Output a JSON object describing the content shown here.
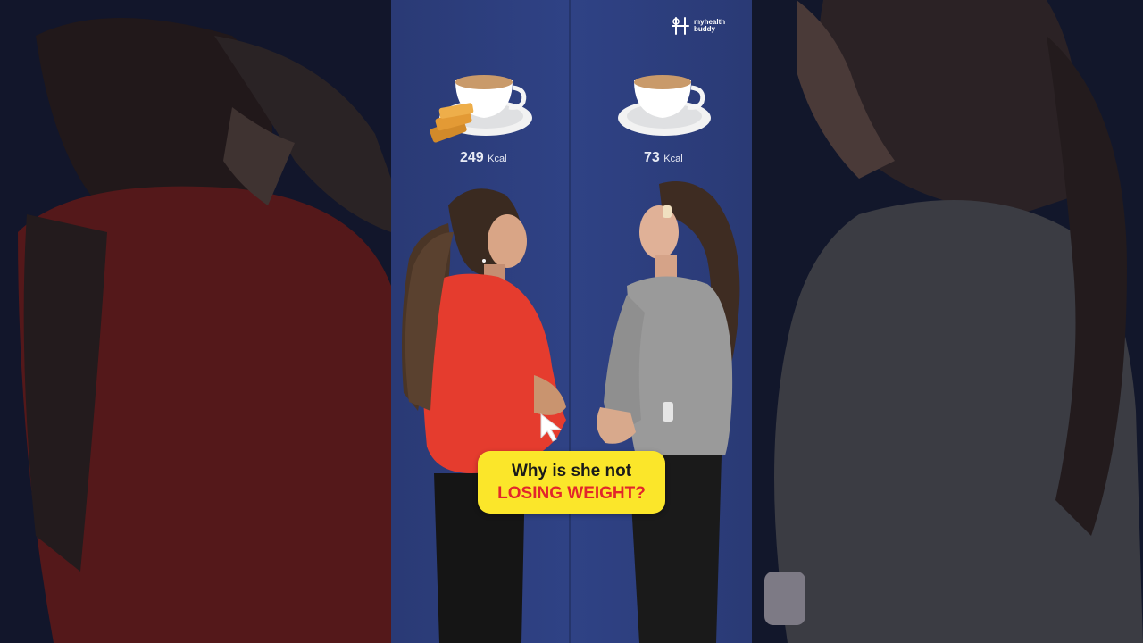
{
  "brand": {
    "logo_text": "myhealth buddy",
    "logo_icon": "stylized-h-icon"
  },
  "left": {
    "kcal_value": "249",
    "kcal_unit": "Kcal",
    "items": [
      "tea-cup-icon",
      "rusk-icon"
    ]
  },
  "right": {
    "kcal_value": "73",
    "kcal_unit": "Kcal",
    "items": [
      "tea-cup-icon"
    ]
  },
  "caption": {
    "line1": "Why is she not",
    "line2": "LOSING WEIGHT?"
  },
  "colors": {
    "background": "#2f4285",
    "caption_bg": "#fbe62a",
    "caption_highlight": "#e2262b",
    "left_sweater": "#e53c2e",
    "right_sweater": "#9a9a9a"
  }
}
